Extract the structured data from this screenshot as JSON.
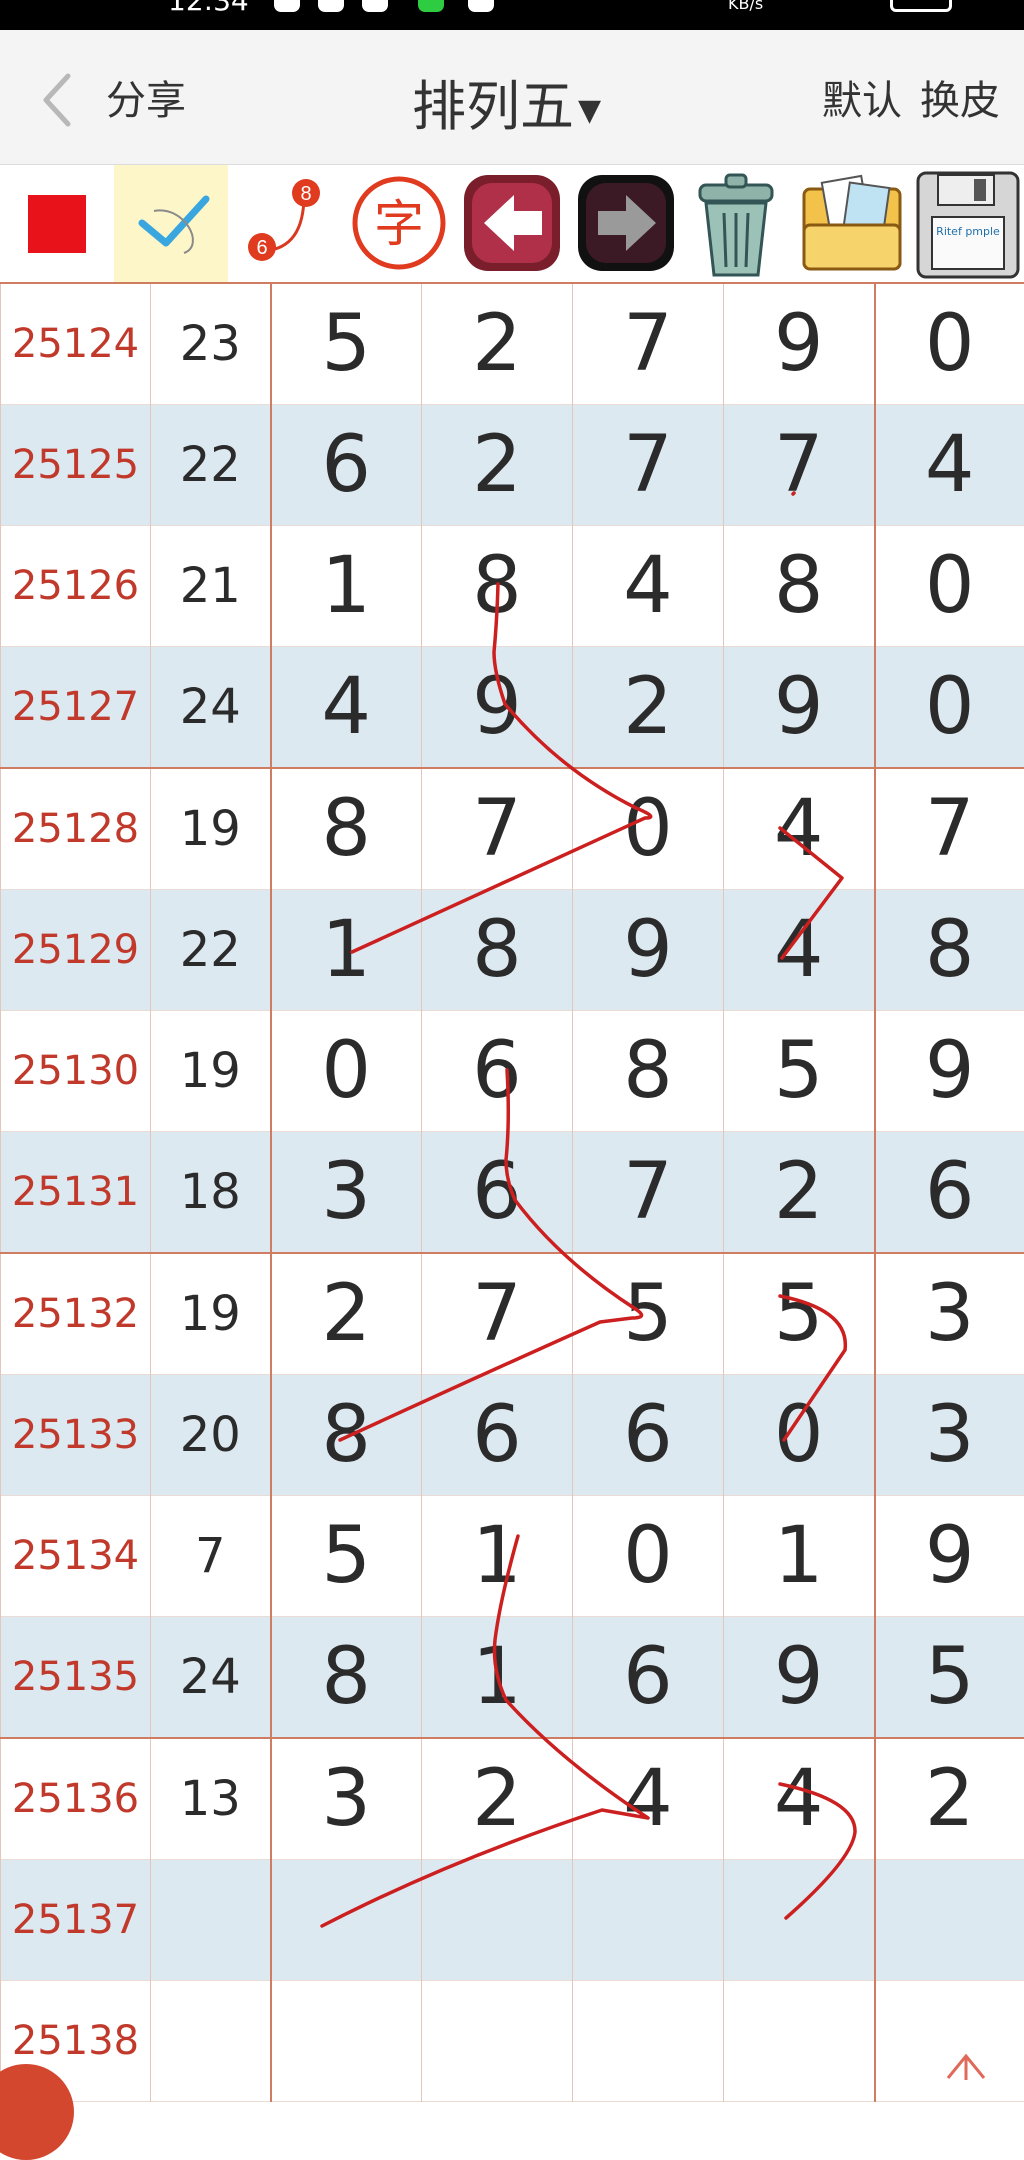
{
  "status_bar": {
    "time": "12:34",
    "speed": "KB/s"
  },
  "header": {
    "back_label": "分享",
    "title": "排列五",
    "right_default": "默认",
    "right_skin": "换皮"
  },
  "toolbar": {
    "icons": [
      "red-square-icon",
      "check-tick-icon",
      "connect-8-6-icon",
      "zi-char-icon",
      "arrow-left-icon",
      "arrow-right-icon",
      "trash-bin-icon",
      "photo-folder-icon",
      "floppy-disk-icon"
    ],
    "connect_top": "8",
    "connect_bottom": "6",
    "zi_char": "字",
    "disk_label": "Ritef\npmple",
    "red_color": "#e8131a"
  },
  "rows": [
    {
      "issue": "25124",
      "sum": "23",
      "digits": [
        "5",
        "2",
        "7",
        "9",
        "0"
      ]
    },
    {
      "issue": "25125",
      "sum": "22",
      "digits": [
        "6",
        "2",
        "7",
        "7",
        "4"
      ]
    },
    {
      "issue": "25126",
      "sum": "21",
      "digits": [
        "1",
        "8",
        "4",
        "8",
        "0"
      ]
    },
    {
      "issue": "25127",
      "sum": "24",
      "digits": [
        "4",
        "9",
        "2",
        "9",
        "0"
      ]
    },
    {
      "issue": "25128",
      "sum": "19",
      "digits": [
        "8",
        "7",
        "0",
        "4",
        "7"
      ]
    },
    {
      "issue": "25129",
      "sum": "22",
      "digits": [
        "1",
        "8",
        "9",
        "4",
        "8"
      ]
    },
    {
      "issue": "25130",
      "sum": "19",
      "digits": [
        "0",
        "6",
        "8",
        "5",
        "9"
      ]
    },
    {
      "issue": "25131",
      "sum": "18",
      "digits": [
        "3",
        "6",
        "7",
        "2",
        "6"
      ]
    },
    {
      "issue": "25132",
      "sum": "19",
      "digits": [
        "2",
        "7",
        "5",
        "5",
        "3"
      ]
    },
    {
      "issue": "25133",
      "sum": "20",
      "digits": [
        "8",
        "6",
        "6",
        "0",
        "3"
      ]
    },
    {
      "issue": "25134",
      "sum": "7",
      "digits": [
        "5",
        "1",
        "0",
        "1",
        "9"
      ]
    },
    {
      "issue": "25135",
      "sum": "24",
      "digits": [
        "8",
        "1",
        "6",
        "9",
        "5"
      ]
    },
    {
      "issue": "25136",
      "sum": "13",
      "digits": [
        "3",
        "2",
        "4",
        "4",
        "2"
      ]
    },
    {
      "issue": "25137",
      "sum": "",
      "digits": [
        "",
        "",
        "",
        "",
        ""
      ]
    },
    {
      "issue": "25138",
      "sum": "",
      "digits": [
        "",
        "",
        "",
        "",
        ""
      ]
    }
  ],
  "colors": {
    "issue_text": "#c0392b",
    "row_alt": "#dde9f1",
    "group_line": "#d07c61",
    "ink": "#cc1f1f"
  }
}
